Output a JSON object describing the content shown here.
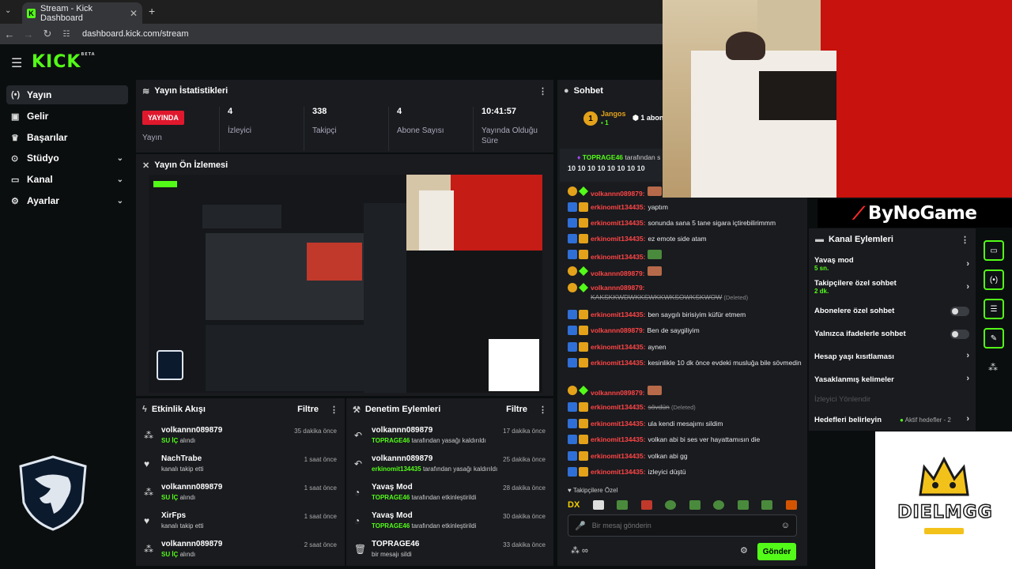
{
  "browser": {
    "tab_title": "Stream - Kick Dashboard",
    "url": "dashboard.kick.com/stream"
  },
  "app": {
    "logo": "KICK",
    "logo_badge": "BETA"
  },
  "sidebar": {
    "items": [
      {
        "label": "Yayın",
        "icon": "broadcast-icon"
      },
      {
        "label": "Gelir",
        "icon": "wallet-icon"
      },
      {
        "label": "Başarılar",
        "icon": "trophy-icon"
      },
      {
        "label": "Stüdyo",
        "icon": "studio-icon"
      },
      {
        "label": "Kanal",
        "icon": "channel-icon"
      },
      {
        "label": "Ayarlar",
        "icon": "gear-icon"
      }
    ]
  },
  "stats": {
    "title": "Yayın İstatistikleri",
    "live_badge": "YAYINDA",
    "live_label": "Yayın",
    "columns": [
      {
        "value": "4",
        "label": "İzleyici"
      },
      {
        "value": "338",
        "label": "Takipçi"
      },
      {
        "value": "4",
        "label": "Abone Sayısı"
      },
      {
        "value": "10:41:57",
        "label": "Yayında Olduğu Süre"
      }
    ]
  },
  "preview": {
    "title": "Yayın Ön İzlemesi"
  },
  "activity": {
    "title": "Etkinlik Akışı",
    "filter": "Filtre",
    "items": [
      {
        "name": "volkannn089879",
        "action_tag": "SU İÇ",
        "action": "alındı",
        "time": "35 dakika önce"
      },
      {
        "name": "NachTrabe",
        "action_tag": "",
        "action": "kanalı takip etti",
        "time": "1 saat önce"
      },
      {
        "name": "volkannn089879",
        "action_tag": "SU İÇ",
        "action": "alındı",
        "time": "1 saat önce"
      },
      {
        "name": "XirFps",
        "action_tag": "",
        "action": "kanalı takip etti",
        "time": "1 saat önce"
      },
      {
        "name": "volkannn089879",
        "action_tag": "SU İÇ",
        "action": "alındı",
        "time": "2 saat önce"
      }
    ]
  },
  "moderation": {
    "title": "Denetim Eylemleri",
    "filter": "Filtre",
    "items": [
      {
        "name": "volkannn089879",
        "actor": "TOPRAGE46",
        "action": "tarafından yasağı kaldırıldı",
        "time": "17 dakika önce"
      },
      {
        "name": "volkannn089879",
        "actor": "erkinomit134435",
        "action": "tarafından yasağı kaldırıldı",
        "time": "25 dakika önce"
      },
      {
        "name": "Yavaş Mod",
        "actor": "TOPRAGE46",
        "action": "tarafından etkinleştirildi",
        "time": "28 dakika önce"
      },
      {
        "name": "Yavaş Mod",
        "actor": "TOPRAGE46",
        "action": "tarafından etkinleştirildi",
        "time": "30 dakika önce"
      },
      {
        "name": "TOPRAGE46",
        "actor": "",
        "action": "bir mesajı sildi",
        "time": "33 dakika önce"
      }
    ]
  },
  "chat": {
    "title": "Sohbet",
    "top_user": "Jangos",
    "top_count": "1",
    "top_sub": "1 abon",
    "pinned_user": "TOPRAGE46",
    "pinned_by": "tarafından s",
    "pinned_text": "10 10 10 10 10 10 10 10",
    "messages": [
      {
        "user": "volkannn089879:",
        "text": "",
        "emote": "red",
        "kind": "gift"
      },
      {
        "user": "erkinomit134435:",
        "text": "yaptım",
        "kind": "mod"
      },
      {
        "user": "erkinomit134435:",
        "text": "sonunda sana 5 tane sigara içtirebilirimmm",
        "kind": "mod"
      },
      {
        "user": "erkinomit134435:",
        "text": "ez emote side atam",
        "kind": "mod"
      },
      {
        "user": "erkinomit134435:",
        "text": "",
        "emote": "green",
        "kind": "mod"
      },
      {
        "user": "volkannn089879:",
        "text": "",
        "emote": "red",
        "kind": "gift"
      },
      {
        "user": "volkannn089879:",
        "text": "KAKSKKWDWKKSWKKWKSOWKSKWOW",
        "deleted": "(Deleted)",
        "kind": "gift"
      },
      {
        "user": "erkinomit134435:",
        "text": "ben saygılı birisiyim küfür etmem",
        "kind": "mod"
      },
      {
        "user": "volkannn089879:",
        "text": "Ben de saygiliyim",
        "kind": "mod"
      },
      {
        "user": "erkinomit134435:",
        "text": "aynen",
        "kind": "mod"
      },
      {
        "user": "erkinomit134435:",
        "text": "kesinlikle 10 dk önce evdeki musluğa bile sövmedin",
        "kind": "mod"
      },
      {
        "user": "volkannn089879:",
        "text": "",
        "emote": "red",
        "kind": "gift"
      },
      {
        "user": "erkinomit134435:",
        "text": "sövdün",
        "deleted": "(Deleted)",
        "kind": "mod"
      },
      {
        "user": "erkinomit134435:",
        "text": "ula kendi mesajımı sildim",
        "kind": "mod"
      },
      {
        "user": "erkinomit134435:",
        "text": "volkan abi bi ses ver hayattamısın die",
        "kind": "mod"
      },
      {
        "user": "erkinomit134435:",
        "text": "volkan abi gg",
        "kind": "mod"
      },
      {
        "user": "erkinomit134435:",
        "text": "izleyici düştü",
        "kind": "mod"
      }
    ],
    "emote_section": "Takipçilere Özel",
    "input_placeholder": "Bir mesaj gönderin",
    "send_label": "Gönder"
  },
  "overlay": {
    "brand": "ByNoGame",
    "sponsor": "DIELMGG"
  },
  "channel_actions": {
    "title": "Kanal Eylemleri",
    "items": [
      {
        "label": "Yavaş mod",
        "sub": "5 sn.",
        "type": "arrow"
      },
      {
        "label": "Takipçilere özel sohbet",
        "sub": "2 dk.",
        "type": "arrow"
      },
      {
        "label": "Abonelere özel sohbet",
        "sub": "",
        "type": "toggle"
      },
      {
        "label": "Yalnızca ifadelerle sohbet",
        "sub": "",
        "type": "toggle"
      },
      {
        "label": "Hesap yaşı kısıtlaması",
        "sub": "",
        "type": "arrow"
      },
      {
        "label": "Yasaklanmış kelimeler",
        "sub": "",
        "type": "arrow"
      },
      {
        "label": "İzleyici Yönlendir",
        "sub": "",
        "type": "disabled"
      },
      {
        "label": "Hedefleri belirleyin",
        "sub": "",
        "type": "goal",
        "goal_text": "Aktif hedefler - 2"
      }
    ]
  },
  "colors": {
    "accent": "#53fc18",
    "live": "#e0182d",
    "panel": "#191b1f",
    "bg": "#0b0e0f"
  }
}
